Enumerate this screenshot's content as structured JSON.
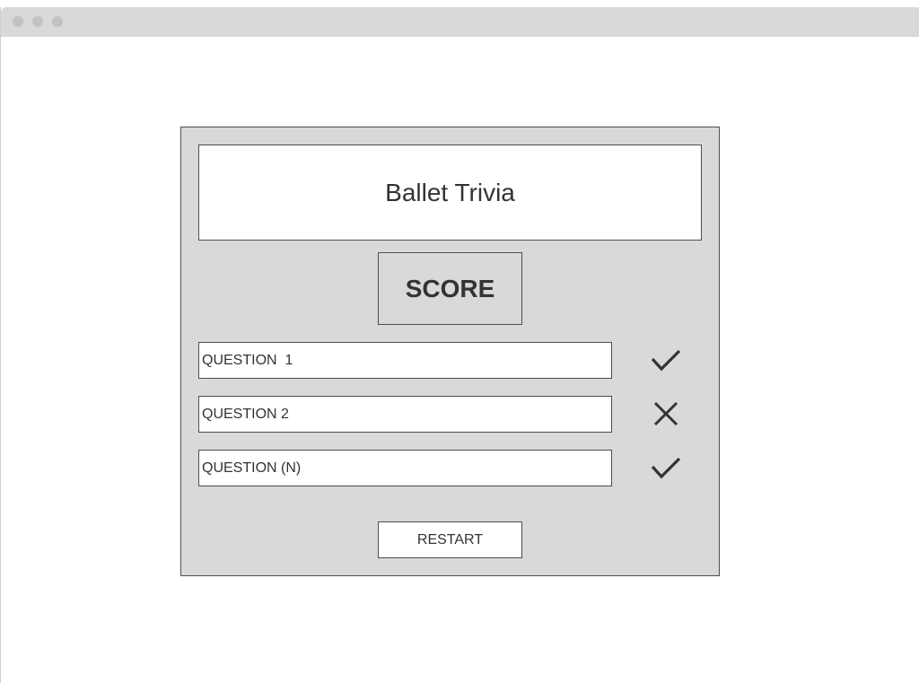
{
  "app": {
    "title": "Ballet Trivia",
    "score_label": "SCORE"
  },
  "questions": [
    {
      "label": "QUESTION  1",
      "result": "correct",
      "icon": "check-icon"
    },
    {
      "label": "QUESTION 2",
      "result": "incorrect",
      "icon": "x-icon"
    },
    {
      "label": "QUESTION (N)",
      "result": "correct",
      "icon": "check-icon"
    }
  ],
  "actions": {
    "restart_label": "RESTART"
  },
  "colors": {
    "panel": "#d9d9d9",
    "border": "#4d4d4d",
    "text": "#333333"
  }
}
